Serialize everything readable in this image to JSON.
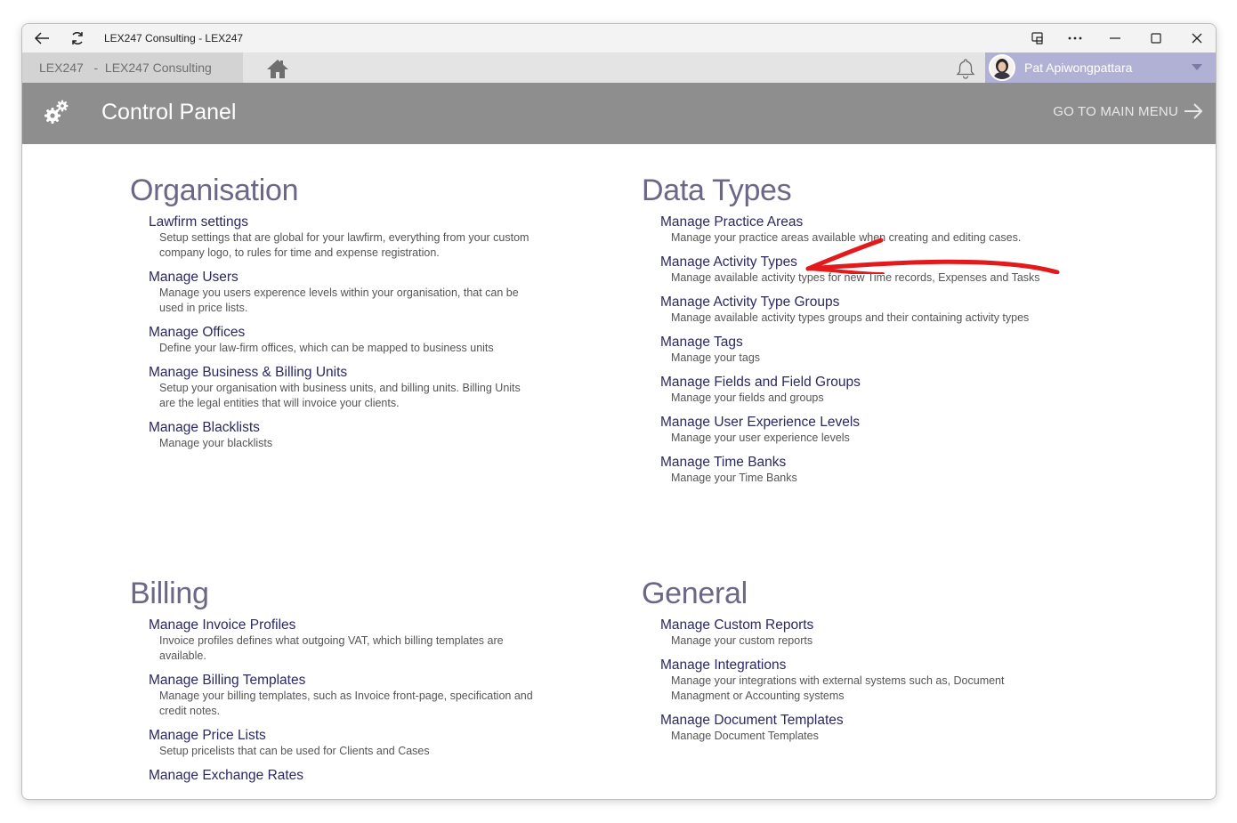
{
  "window": {
    "title": "LEX247 Consulting - LEX247"
  },
  "tabbar": {
    "tab_label": "LEX247   -  LEX247 Consulting",
    "user_name": "Pat Apiwongpattara"
  },
  "header": {
    "title": "Control Panel",
    "main_menu_label": "GO TO MAIN MENU"
  },
  "sections": {
    "organisation": {
      "heading": "Organisation",
      "items": [
        {
          "title": "Lawfirm settings",
          "desc": "Setup settings that are global for your lawfirm, everything from your custom company logo, to rules for time and expense registration."
        },
        {
          "title": "Manage Users",
          "desc": "Manage you users experence levels within your organisation, that can be used in price lists."
        },
        {
          "title": "Manage Offices",
          "desc": "Define your law-firm offices, which can be mapped to business units"
        },
        {
          "title": "Manage Business & Billing Units",
          "desc": "Setup your organisation with business units, and billing units. Billing Units are the legal entities that will invoice your clients."
        },
        {
          "title": "Manage Blacklists",
          "desc": "Manage your blacklists"
        }
      ]
    },
    "data_types": {
      "heading": "Data Types",
      "items": [
        {
          "title": "Manage Practice Areas",
          "desc": "Manage your practice areas available when creating and editing cases."
        },
        {
          "title": "Manage Activity Types",
          "desc": "Manage available activity types for new Time records, Expenses and Tasks"
        },
        {
          "title": "Manage Activity Type Groups",
          "desc": "Manage available activity types groups and their containing activity types"
        },
        {
          "title": "Manage Tags",
          "desc": "Manage your tags"
        },
        {
          "title": "Manage Fields and Field Groups",
          "desc": "Manage your fields and groups"
        },
        {
          "title": "Manage User Experience Levels",
          "desc": "Manage your user experience levels"
        },
        {
          "title": "Manage Time Banks",
          "desc": "Manage your Time Banks"
        }
      ]
    },
    "billing": {
      "heading": "Billing",
      "items": [
        {
          "title": "Manage Invoice Profiles",
          "desc": "Invoice profiles defines what outgoing VAT, which billing templates are available."
        },
        {
          "title": "Manage Billing Templates",
          "desc": "Manage your billing templates, such as Invoice front-page, specification and credit notes."
        },
        {
          "title": "Manage Price Lists",
          "desc": "Setup pricelists that can be used for Clients and Cases"
        },
        {
          "title": "Manage Exchange Rates",
          "desc": ""
        }
      ]
    },
    "general": {
      "heading": "General",
      "items": [
        {
          "title": "Manage Custom Reports",
          "desc": "Manage your custom reports"
        },
        {
          "title": "Manage Integrations",
          "desc": "Manage your integrations with external systems such as, Document Managment or Accounting systems"
        },
        {
          "title": "Manage Document Templates",
          "desc": "Manage Document Templates"
        }
      ]
    }
  },
  "colors": {
    "header_bg": "#8e8e8e",
    "user_area_bg": "#b1b1d6",
    "link": "#2b2862",
    "annotation": "#e3191c"
  }
}
